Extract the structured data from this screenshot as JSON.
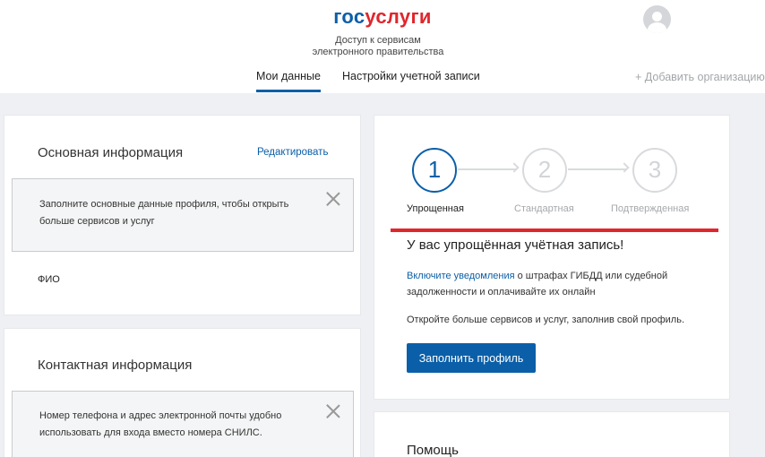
{
  "header": {
    "logo_part1": "гос",
    "logo_part2": "услуги",
    "tagline_line1": "Доступ к сервисам",
    "tagline_line2": "электронного правительства",
    "tabs": [
      {
        "label": "Мои данные",
        "active": true
      },
      {
        "label": "Настройки учетной записи",
        "active": false
      }
    ],
    "add_org": "+ Добавить организацию"
  },
  "main_info": {
    "title": "Основная информация",
    "edit_label": "Редактировать",
    "notice": "Заполните основные данные профиля, чтобы открыть больше сервисов и услуг",
    "fio_label": "ФИО"
  },
  "contact_info": {
    "title": "Контактная информация",
    "notice": "Номер телефона и адрес электронной почты удобно использовать для входа вместо номера СНИЛС."
  },
  "account_status": {
    "steps": [
      {
        "number": "1",
        "label": "Упрощенная",
        "active": true
      },
      {
        "number": "2",
        "label": "Стандартная",
        "active": false
      },
      {
        "number": "3",
        "label": "Подтвержденная",
        "active": false
      }
    ],
    "title": "У вас упрощённая учётная запись!",
    "link_text": "Включите уведомления",
    "text_after_link": " о штрафах ГИБДД или судебной задолженности и оплачивайте их онлайн",
    "text2": "Откройте больше сервисов и услуг, заполнив свой профиль.",
    "button_label": "Заполнить профиль"
  },
  "help": {
    "title": "Помощь"
  },
  "colors": {
    "primary": "#0b5fa8",
    "accent_red": "#e0262d",
    "background": "#eef0f3"
  }
}
